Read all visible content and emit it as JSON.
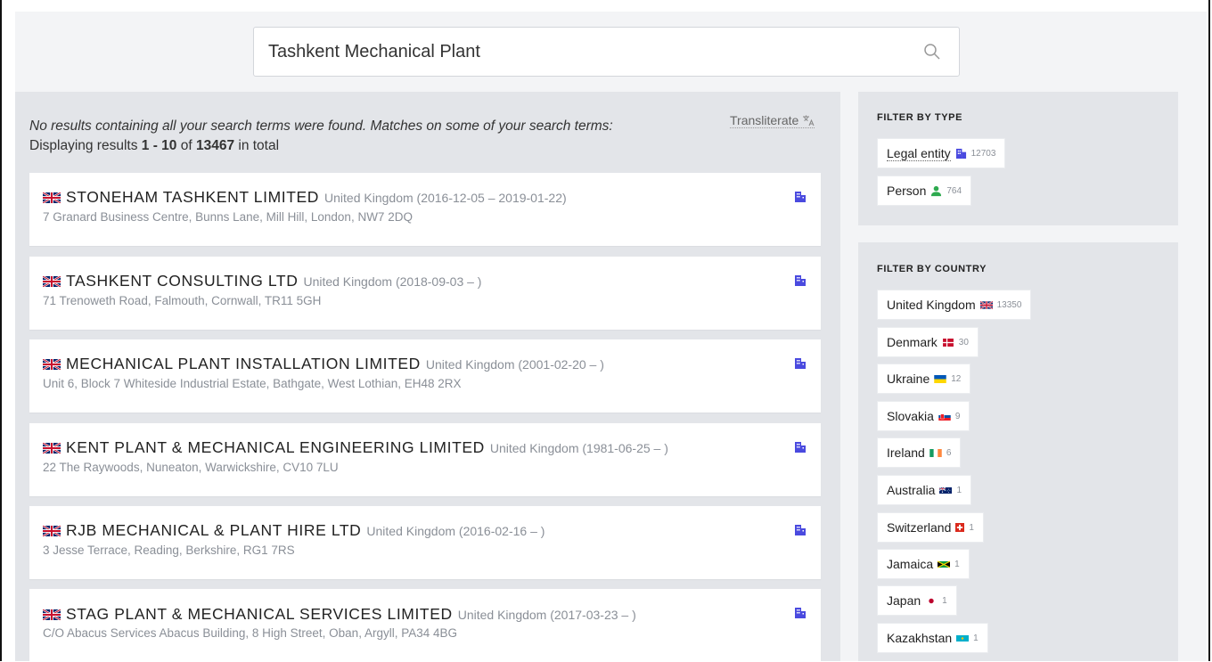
{
  "search": {
    "value": "Tashkent Mechanical Plant"
  },
  "notice": {
    "line1": "No results containing all your search terms were found. Matches on some of your search terms:",
    "prefix": "Displaying results ",
    "range": "1 - 10",
    "of": " of ",
    "total": "13467",
    "suffix": " in total"
  },
  "transliterate_label": "Transliterate",
  "results": [
    {
      "name": "STONEHAM TASHKENT LIMITED",
      "meta": "United Kingdom (2016-12-05 – 2019-01-22)",
      "address": "7 Granard Business Centre, Bunns Lane, Mill Hill, London, NW7 2DQ"
    },
    {
      "name": "TASHKENT CONSULTING LTD",
      "meta": "United Kingdom (2018-09-03 – )",
      "address": "71 Trenoweth Road, Falmouth, Cornwall, TR11 5GH"
    },
    {
      "name": "MECHANICAL PLANT INSTALLATION LIMITED",
      "meta": "United Kingdom (2001-02-20 – )",
      "address": "Unit 6, Block 7 Whiteside Industrial Estate, Bathgate, West Lothian, EH48 2RX"
    },
    {
      "name": "KENT PLANT & MECHANICAL ENGINEERING LIMITED",
      "meta": "United Kingdom (1981-06-25 – )",
      "address": "22 The Raywoods, Nuneaton, Warwickshire, CV10 7LU"
    },
    {
      "name": "RJB MECHANICAL & PLANT HIRE LTD",
      "meta": "United Kingdom (2016-02-16 – )",
      "address": "3 Jesse Terrace, Reading, Berkshire, RG1 7RS"
    },
    {
      "name": "STAG PLANT & MECHANICAL SERVICES LIMITED",
      "meta": "United Kingdom (2017-03-23 – )",
      "address": "C/O Abacus Services Abacus Building, 8 High Street, Oban, Argyll, PA34 4BG"
    }
  ],
  "filter_type": {
    "title": "FILTER BY TYPE",
    "items": [
      {
        "label": "Legal entity",
        "count": "12703"
      },
      {
        "label": "Person",
        "count": "764"
      }
    ]
  },
  "filter_country": {
    "title": "FILTER BY COUNTRY",
    "items": [
      {
        "label": "United Kingdom",
        "count": "13350"
      },
      {
        "label": "Denmark",
        "count": "30"
      },
      {
        "label": "Ukraine",
        "count": "12"
      },
      {
        "label": "Slovakia",
        "count": "9"
      },
      {
        "label": "Ireland",
        "count": "6"
      },
      {
        "label": "Australia",
        "count": "1"
      },
      {
        "label": "Switzerland",
        "count": "1"
      },
      {
        "label": "Jamaica",
        "count": "1"
      },
      {
        "label": "Japan",
        "count": "1"
      },
      {
        "label": "Kazakhstan",
        "count": "1"
      }
    ]
  },
  "colors": {
    "entity_icon": "#4a4adf",
    "person_icon": "#2eaa4f",
    "page_bg": "#f3f4f6",
    "panel_bg": "#e3e5e9"
  }
}
